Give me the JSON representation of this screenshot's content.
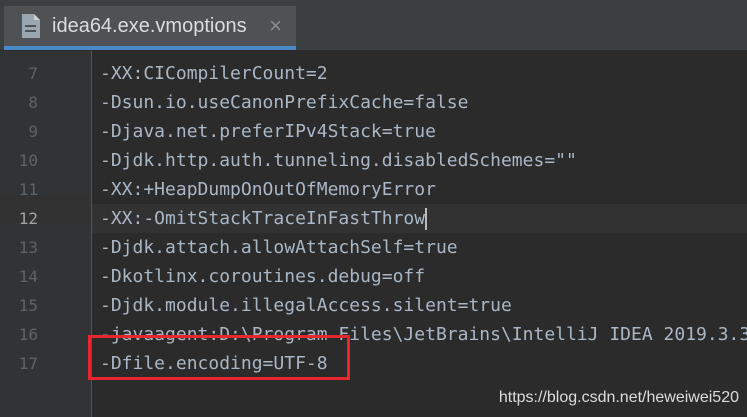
{
  "tab": {
    "title": "idea64.exe.vmoptions",
    "close_glyph": "×",
    "icon": "file-icon"
  },
  "editor": {
    "current_line": "12",
    "lines": [
      {
        "number": "7",
        "text": "-XX:CICompilerCount=2"
      },
      {
        "number": "8",
        "text": "-Dsun.io.useCanonPrefixCache=false"
      },
      {
        "number": "9",
        "text": "-Djava.net.preferIPv4Stack=true"
      },
      {
        "number": "10",
        "text": "-Djdk.http.auth.tunneling.disabledSchemes=\"\""
      },
      {
        "number": "11",
        "text": "-XX:+HeapDumpOnOutOfMemoryError"
      },
      {
        "number": "12",
        "text": "-XX:-OmitStackTraceInFastThrow"
      },
      {
        "number": "13",
        "text": "-Djdk.attach.allowAttachSelf=true"
      },
      {
        "number": "14",
        "text": "-Dkotlinx.coroutines.debug=off"
      },
      {
        "number": "15",
        "text": "-Djdk.module.illegalAccess.silent=true"
      },
      {
        "number": "16",
        "text": "-javaagent:D:\\Program Files\\JetBrains\\IntelliJ IDEA 2019.3.3"
      },
      {
        "number": "17",
        "text": "-Dfile.encoding=UTF-8"
      }
    ]
  },
  "watermark": "https://blog.csdn.net/heweiwei520",
  "colors": {
    "accent": "#4a88c7",
    "highlight_box": "#e8262e",
    "code_text": "#a9b7c6"
  }
}
